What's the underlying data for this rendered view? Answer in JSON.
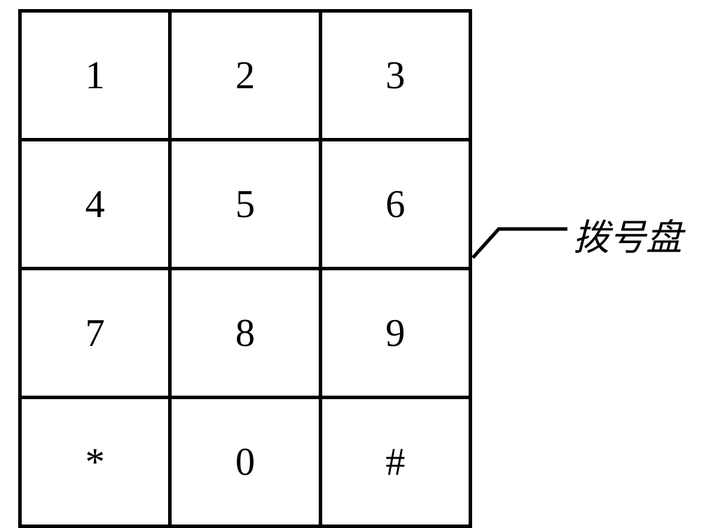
{
  "keypad": {
    "rows": [
      [
        "1",
        "2",
        "3"
      ],
      [
        "4",
        "5",
        "6"
      ],
      [
        "7",
        "8",
        "9"
      ],
      [
        "*",
        "0",
        "#"
      ]
    ]
  },
  "label": {
    "text": "拨号盘"
  }
}
